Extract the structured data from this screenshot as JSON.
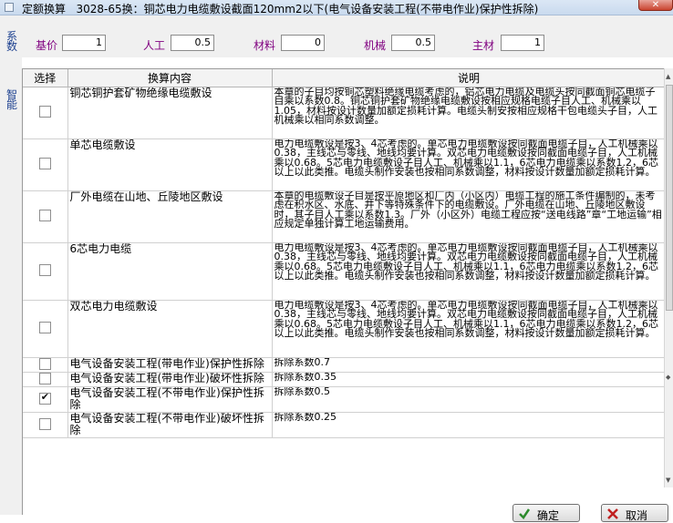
{
  "window": {
    "tab_title": "定额换算",
    "title": "3028-65换：铜芯电力电缆敷设截面120mm2以下(电气设备安装工程(不带电作业)保护性拆除)"
  },
  "sidebar": {
    "coefficient_label": "系数",
    "smart_label": "智能"
  },
  "coefficients": [
    {
      "label": "基价",
      "value": "1"
    },
    {
      "label": "人工",
      "value": "0.5"
    },
    {
      "label": "材料",
      "value": "0"
    },
    {
      "label": "机械",
      "value": "0.5"
    },
    {
      "label": "主材",
      "value": "1"
    }
  ],
  "table": {
    "headers": {
      "select": "选择",
      "content": "换算内容",
      "description": "说明"
    },
    "rows": [
      {
        "checked": false,
        "content": "铜芯铜护套矿物绝缘电缆敷设",
        "description": "本章的子目均按铜芯塑料绝缘电缆考虑的，铝芯电力电缆及电缆头按同截面铜芯电缆子目乘以系数0.8。铜芯铜护套矿物绝缘电缆敷设按相应规格电缆子目人工、机械乘以1.05，材料按设计数量加额定损耗计算。电缆头制安按相应规格干包电缆头子目，人工机械乘以相同系数调整。"
      },
      {
        "checked": false,
        "content": "单芯电缆敷设",
        "description": "电力电缆敷设是按3、4芯考虑的。单芯电力电缆敷设按同截面电缆子目，人工机械乘以0.38，主线芯与零线、地线均要计算。双芯电力电缆敷设按同截面电缆子目，人工机械乘以0.68。5芯电力电缆敷设子目人工、机械乘以1.1，6芯电力电缆乘以系数1.2，6芯以上以此类推。电缆头制作安装也按相同系数调整，材料按设计数量加额定损耗计算。"
      },
      {
        "checked": false,
        "content": "厂外电缆在山地、丘陵地区敷设",
        "description": "本章的电缆敷设子目是按平原地区和厂内（小区内）电缆工程的施工条件编制的，未考虑在积水区、水底、井下等特殊条件下的电缆敷设。厂外电缆在山地、丘陵地区敷设时，其子目人工乘以系数1.3。厂外（小区外）电缆工程应按“送电线路”章“工地运输”相应规定单独计算工地运输费用。"
      },
      {
        "checked": false,
        "content": "6芯电力电缆",
        "description": "电力电缆敷设是按3、4芯考虑的。单芯电力电缆敷设按同截面电缆子目，人工机械乘以0.38，主线芯与零线、地线均要计算。双芯电力电缆敷设按同截面电缆子目，人工机械乘以0.68。5芯电力电缆敷设子目人工、机械乘以1.1，6芯电力电缆乘以系数1.2，6芯以上以此类推。电缆头制作安装也按相同系数调整，材料按设计数量加额定损耗计算。"
      },
      {
        "checked": false,
        "content": "双芯电力电缆敷设",
        "description": "电力电缆敷设是按3、4芯考虑的。单芯电力电缆敷设按同截面电缆子目，人工机械乘以0.38，主线芯与零线、地线均要计算。双芯电力电缆敷设按同截面电缆子目，人工机械乘以0.68。5芯电力电缆敷设子目人工、机械乘以1.1，6芯电力电缆乘以系数1.2，6芯以上以此类推。电缆头制作安装也按相同系数调整，材料按设计数量加额定损耗计算。"
      },
      {
        "checked": false,
        "content": "电气设备安装工程(带电作业)保护性拆除",
        "description": "拆除系数0.7"
      },
      {
        "checked": false,
        "content": "电气设备安装工程(带电作业)破坏性拆除",
        "description": "拆除系数0.35"
      },
      {
        "checked": true,
        "content": "电气设备安装工程(不带电作业)保护性拆除",
        "description": "拆除系数0.5"
      },
      {
        "checked": false,
        "content": "电气设备安装工程(不带电作业)破坏性拆除",
        "description": "拆除系数0.25"
      }
    ]
  },
  "buttons": {
    "ok": "确定",
    "cancel": "取消"
  },
  "colors": {
    "coef_label": "#800080",
    "side_label": "#1b3f8f"
  }
}
